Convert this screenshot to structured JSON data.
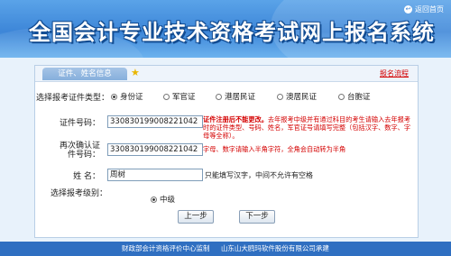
{
  "header": {
    "title": "全国会计专业技术资格考试网上报名系统",
    "back_label": "返回首页"
  },
  "tabs": {
    "active_label": "证件、姓名信息",
    "process_link": "报名流程"
  },
  "form": {
    "id_type": {
      "label": "选择报考证件类型：",
      "options": [
        "身份证",
        "军官证",
        "港居民证",
        "澳居民证",
        "台胞证"
      ],
      "selected": "身份证"
    },
    "id_number": {
      "label": "证件号码：",
      "value": "330830199008221042",
      "note_bold": "证件注册后不能更改。",
      "note_rest": "去年报考中级并有通过科目的考生请输入去年报考时的证件类型、号码、姓名，军官证号请填写完整（包括汉字、数字、字母等全称）。"
    },
    "id_confirm": {
      "label": "再次确认证件号码：",
      "value": "330830199008221042",
      "note": "字母、数字请输入半角字符，全角会自动转为半角"
    },
    "name": {
      "label": "姓  名：",
      "value": "周树",
      "note": "只能填写汉字，中间不允许有空格"
    },
    "level": {
      "label": "选择报考级别：",
      "option": "中级"
    }
  },
  "buttons": {
    "prev": "上一步",
    "next": "下一步"
  },
  "footer": {
    "left": "财政部会计资格评价中心监制",
    "right": "山东山大鸥玛软件股份有限公司承建"
  }
}
